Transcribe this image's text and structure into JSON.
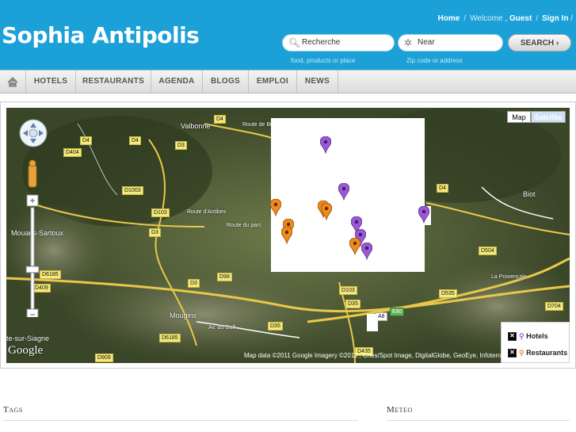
{
  "site": {
    "title": "Sophia Antipolis"
  },
  "toplinks": {
    "home": "Home",
    "welcome": "Welcome ,",
    "guest": "Guest",
    "signin": "Sign In",
    "sep": "/"
  },
  "search": {
    "query_placeholder": "Recherche",
    "query_hint": "food, products or place",
    "near_placeholder": "Near",
    "near_hint": "Zip code or address",
    "button_label": "SEARCH ›"
  },
  "nav": {
    "items": [
      "HOTELS",
      "RESTAURANTS",
      "AGENDA",
      "BLOGS",
      "EMPLOI",
      "NEWS"
    ]
  },
  "map": {
    "type_map": "Map",
    "type_satellite": "Satellite",
    "legend": {
      "hotels": "Hotels",
      "restaurants": "Restaurants"
    },
    "google": "Google",
    "attribution": "Map data ©2011 Google Imagery ©2011 , Cnes/Spot Image, DigitalGlobe, GeoEye, Infoterra",
    "places": [
      "Valbonne",
      "Biot",
      "Mougins",
      "Mouans-Sartoux",
      "te-sur-Siagne"
    ],
    "roads": [
      "D4",
      "D3",
      "D404",
      "D1003",
      "D103",
      "D6185",
      "D409",
      "D98",
      "D35",
      "D435",
      "D504",
      "D535",
      "D704",
      "D909",
      "E80",
      "A8",
      "Route de Biot",
      "Route d'Antibes",
      "Route du parc",
      "La Provençale",
      "Av. du Golf"
    ],
    "colors": {
      "hotel": "#9b59d6",
      "restaurant": "#f08a1c"
    }
  },
  "sections": {
    "tags": "Tags",
    "meteo": "Meteo"
  }
}
